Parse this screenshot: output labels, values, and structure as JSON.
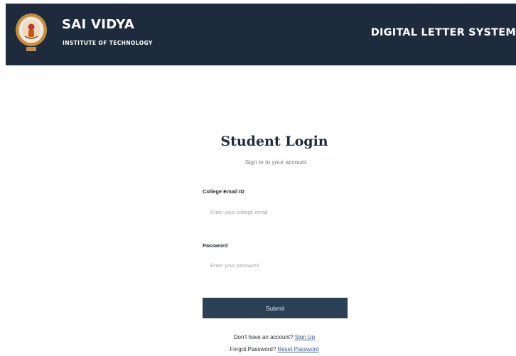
{
  "header": {
    "brand_name": "SAI VIDYA",
    "brand_subtitle": "INSTITUTE OF TECHNOLOGY",
    "system_title": "DIGITAL LETTER SYSTEM",
    "logo_icon": "college-emblem",
    "background_color": "#1e2b3c"
  },
  "login": {
    "title": "Student Login",
    "subtitle": "Sign in to your account",
    "email": {
      "label": "College Email ID",
      "placeholder": "Enter your college email",
      "value": ""
    },
    "password": {
      "label": "Password",
      "placeholder": "Enter your password",
      "value": ""
    },
    "submit_label": "Submit",
    "submit_color": "#2b4055"
  },
  "footer_links": {
    "signup_prompt": "Don't have an account?",
    "signup_link": "Sign Up",
    "reset_prompt": "Forgot Password?",
    "reset_link": "Reset Password",
    "link_color": "#3a5f9a"
  }
}
